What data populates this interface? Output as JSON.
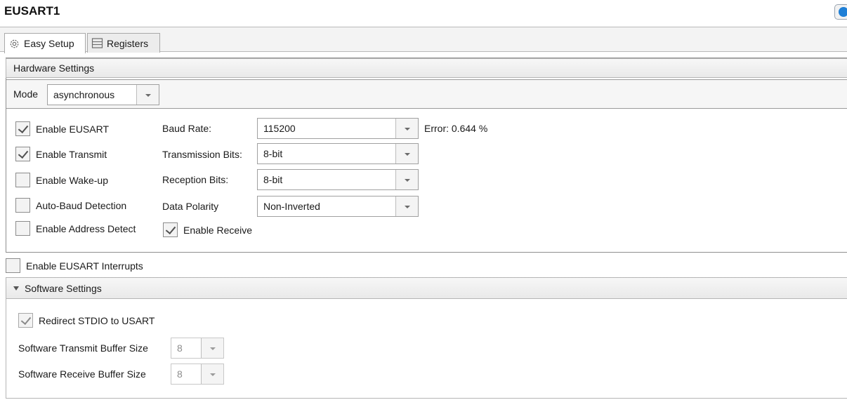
{
  "window": {
    "title": "EUSART1"
  },
  "tabs": [
    {
      "label": "Easy Setup",
      "icon": "gear-icon",
      "active": true
    },
    {
      "label": "Registers",
      "icon": "register-list-icon",
      "active": false
    }
  ],
  "hardware": {
    "header": "Hardware Settings",
    "mode": {
      "label": "Mode",
      "value": "asynchronous"
    },
    "checkboxes": [
      {
        "label": "Enable EUSART",
        "checked": true
      },
      {
        "label": "Enable Transmit",
        "checked": true
      },
      {
        "label": "Enable Wake-up",
        "checked": false
      },
      {
        "label": "Auto-Baud Detection",
        "checked": false
      },
      {
        "label": "Enable Address Detect",
        "checked": false
      }
    ],
    "fields": [
      {
        "label": "Baud Rate:",
        "value": "115200"
      },
      {
        "label": "Transmission Bits:",
        "value": "8-bit"
      },
      {
        "label": "Reception Bits:",
        "value": "8-bit"
      },
      {
        "label": "Data Polarity",
        "value": "Non-Inverted"
      }
    ],
    "error_text": "Error: 0.644 %",
    "enable_receive": {
      "label": "Enable Receive",
      "checked": true
    }
  },
  "interrupts": {
    "label": "Enable EUSART Interrupts",
    "checked": false
  },
  "software": {
    "header": "Software Settings",
    "redirect": {
      "label": "Redirect STDIO to USART",
      "checked": true
    },
    "tx_buffer": {
      "label": "Software Transmit Buffer Size",
      "value": "8"
    },
    "rx_buffer": {
      "label": "Software Receive Buffer Size",
      "value": "8"
    }
  },
  "colors": {
    "help_accent": "#1f7fd6",
    "border": "#a0a0a0"
  }
}
